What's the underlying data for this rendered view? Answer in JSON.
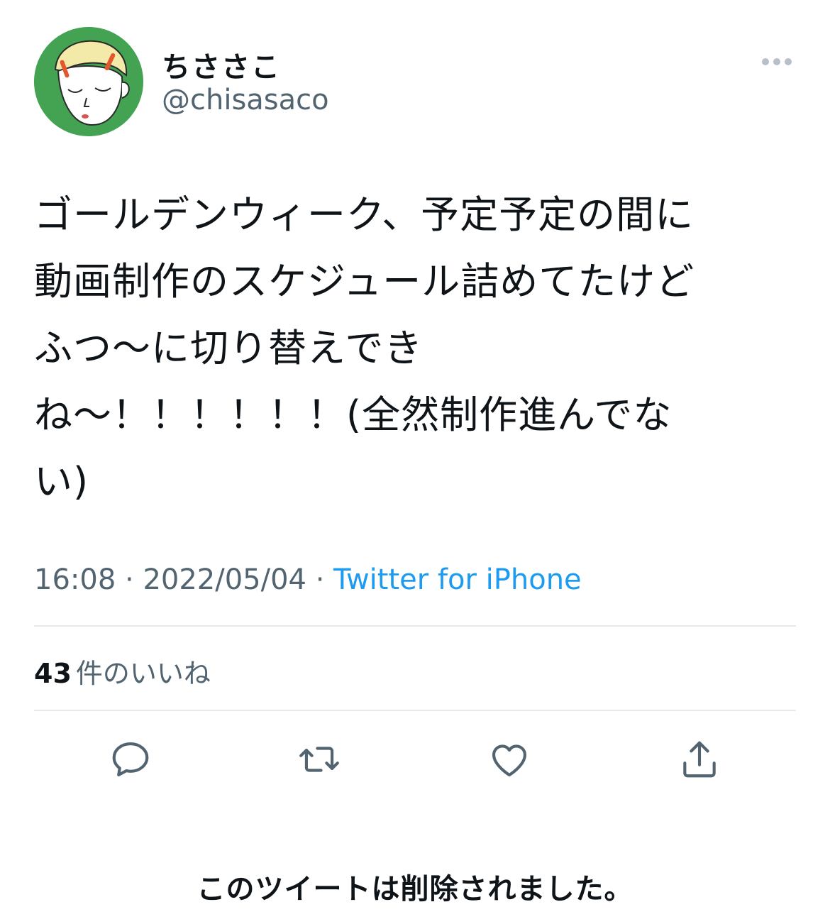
{
  "author": {
    "display_name": "ちささこ",
    "handle": "@chisasaco",
    "avatar": "illustrated-face-avatar"
  },
  "tweet": {
    "text_lines": [
      "ゴールデンウィーク、予定予定の間に",
      "動画制作のスケジュール詰めてたけど",
      "ふつ〜に切り替えでき",
      "ね〜！！！！！！(全然制作進んでな",
      "い)"
    ],
    "time": "16:08",
    "separator": "·",
    "date": "2022/05/04",
    "source": "Twitter for iPhone"
  },
  "likes": {
    "count": "43",
    "label": "件のいいね"
  },
  "actions": {
    "reply": "reply-icon",
    "retweet": "retweet-icon",
    "like": "heart-icon",
    "share": "share-icon",
    "more": "more-icon"
  },
  "footer": {
    "deleted_notice": "このツイートは削除されました。"
  },
  "colors": {
    "text": "#0f1419",
    "secondary": "#536471",
    "link": "#1d9bf0",
    "divider": "#e6e9eb",
    "avatar_bg": "#43a352"
  }
}
